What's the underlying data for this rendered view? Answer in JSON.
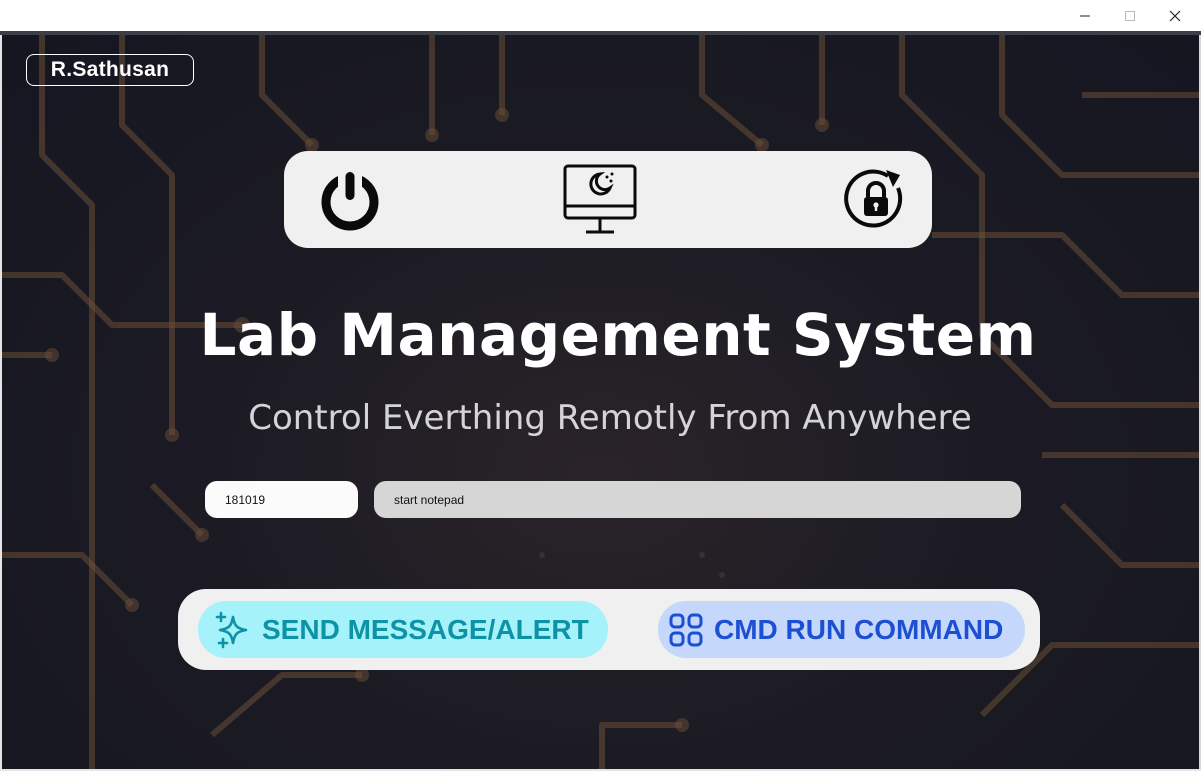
{
  "window": {
    "controls": [
      "minimize-icon",
      "maximize-icon",
      "close-icon"
    ]
  },
  "header": {
    "author": "R.Sathusan"
  },
  "actions": [
    {
      "name": "shutdown",
      "icon": "power-icon"
    },
    {
      "name": "sleep",
      "icon": "monitor-sleep-icon"
    },
    {
      "name": "lock",
      "icon": "lock-refresh-icon"
    }
  ],
  "hero": {
    "title": "Lab Management System",
    "subtitle": "Control Everthing Remotly From Anywhere"
  },
  "inputs": {
    "pc_id": "181019",
    "command": "start notepad"
  },
  "buttons": {
    "send_label": "SEND MESSAGE/ALERT",
    "send_icon": "sparkles-icon",
    "cmd_label": "CMD RUN COMMAND",
    "cmd_icon": "grid-apps-icon"
  },
  "colors": {
    "background": "#171822",
    "circuit": "#6a4e36",
    "panel": "#f0f0f0",
    "send_bg": "#a5f2fa",
    "send_text": "#0e93a6",
    "cmd_bg": "#c5d8fb",
    "cmd_text": "#1d4fd2"
  }
}
